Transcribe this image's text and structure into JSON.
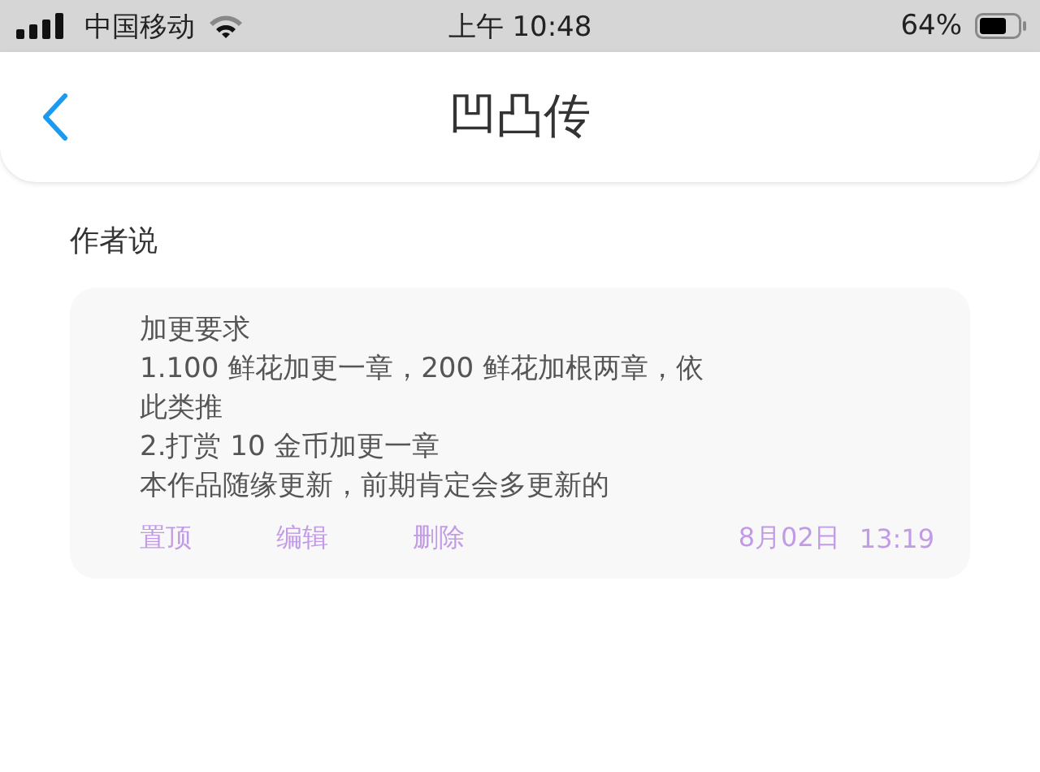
{
  "status_bar": {
    "carrier": "中国移动",
    "time": "上午 10:48",
    "battery": "64%"
  },
  "header": {
    "title": "凹凸传"
  },
  "section": {
    "title": "作者说"
  },
  "note": {
    "lines": [
      "加更要求",
      "1.100 鲜花加更一章，200 鲜花加根两章，依",
      "此类推",
      "2.打赏 10 金币加更一章",
      "本作品随缘更新，前期肯定会多更新的"
    ],
    "actions": [
      "置顶",
      "编辑",
      "删除"
    ],
    "date": "8月02日",
    "time": "13:19"
  }
}
